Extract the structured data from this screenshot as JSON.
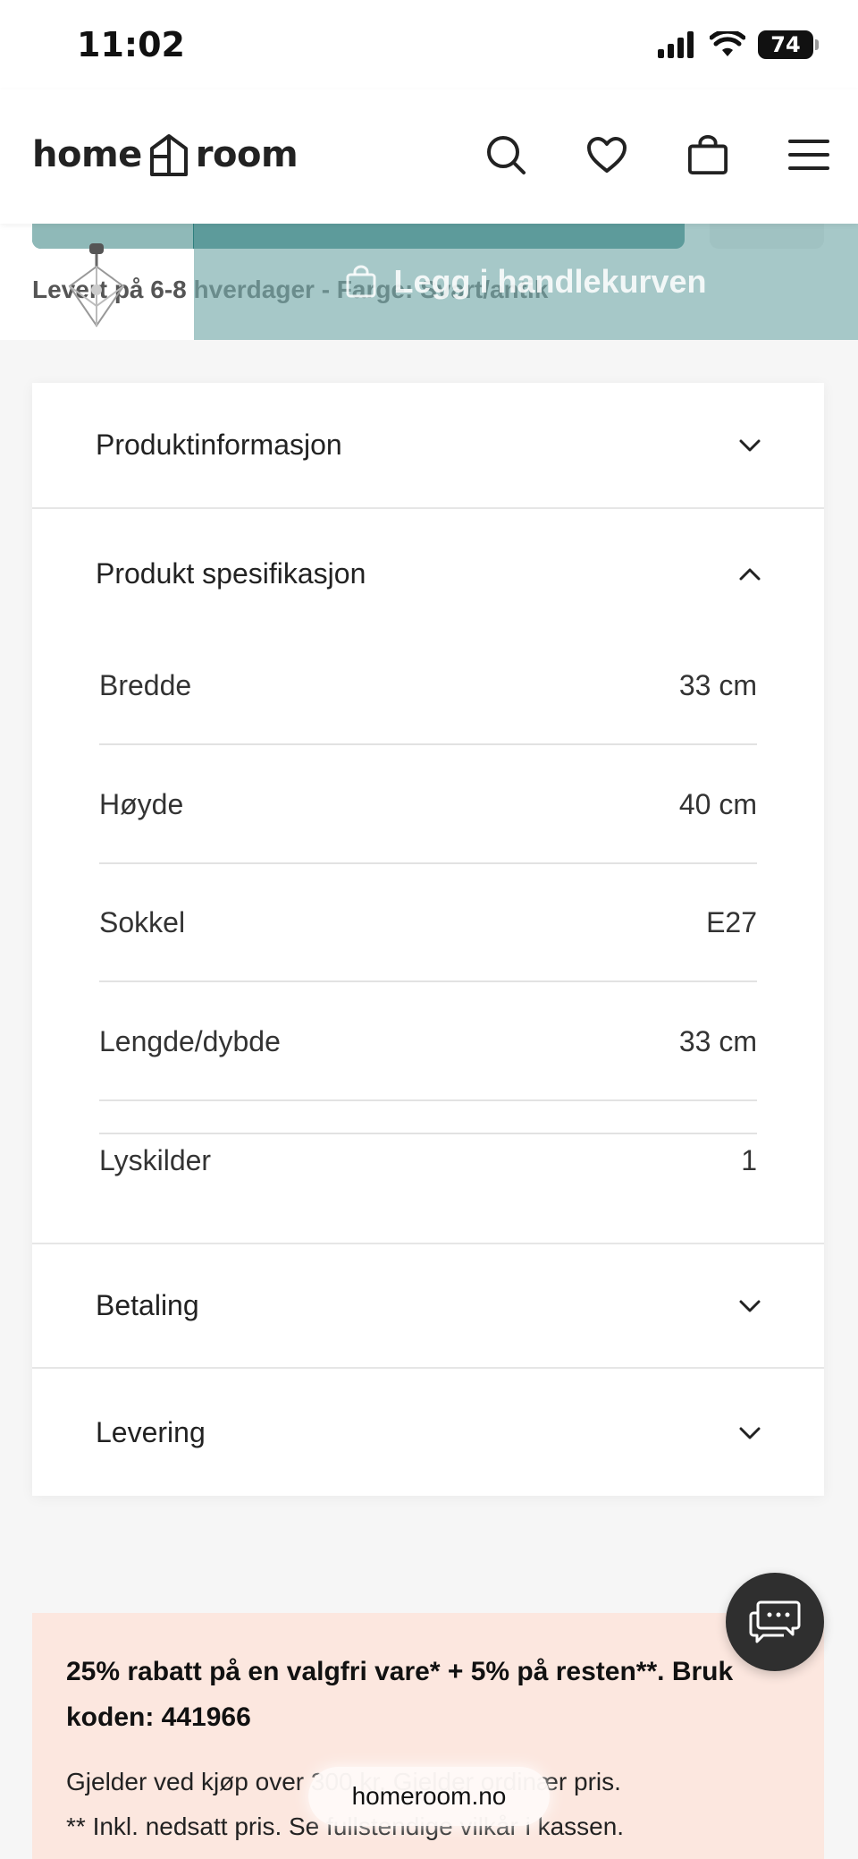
{
  "status_bar": {
    "time": "11:02",
    "battery": "74"
  },
  "header": {
    "logo_left": "home",
    "logo_right": "room",
    "icons": [
      "search-icon",
      "heart-icon",
      "bag-icon",
      "menu-icon"
    ]
  },
  "sticky": {
    "delivery_text": "Levert på 6-8 hverdager - Farge: Svart/antik",
    "add_to_cart_label": "Legg i handlekurven"
  },
  "accordion": {
    "product_info": "Produktinformasjon",
    "product_spec": "Produkt spesifikasjon",
    "payment": "Betaling",
    "delivery": "Levering"
  },
  "specs": [
    {
      "label": "Bredde",
      "value": "33 cm"
    },
    {
      "label": "Høyde",
      "value": "40 cm"
    },
    {
      "label": "Sokkel",
      "value": "E27"
    },
    {
      "label": "Lengde/dybde",
      "value": "33 cm"
    },
    {
      "label": "Lyskilder",
      "value": "1"
    }
  ],
  "promo": {
    "title": "25% rabatt på en valgfri vare* + 5% på resten**. Bruk koden: 441966",
    "line1": "Gjelder ved kjøp over 300 kr. Gjelder ordinær pris.",
    "line2": "** Inkl. nedsatt pris. Se fullstendige vilkår i kassen."
  },
  "browser": {
    "url": "homeroom.no"
  },
  "colors": {
    "teal": "#2e7f7e",
    "promo_bg": "#fce7df",
    "chat_bg": "#2f2f2f"
  }
}
